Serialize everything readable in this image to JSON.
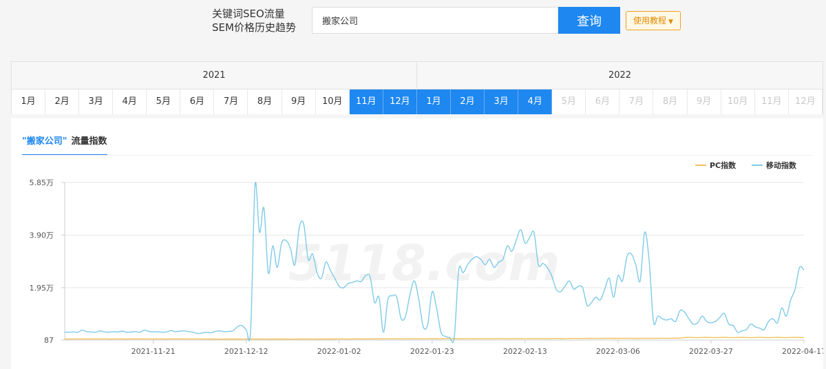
{
  "header": {
    "label_line1": "关键词SEO流量",
    "label_line2": "SEM价格历史趋势",
    "search_value": "搬家公司",
    "search_button": "查询",
    "tutorial_button": "使用教程",
    "accent_color": "#1e87f0"
  },
  "months": {
    "years": [
      "2021",
      "2022"
    ],
    "year_2021": [
      {
        "label": "1月",
        "state": "normal"
      },
      {
        "label": "2月",
        "state": "normal"
      },
      {
        "label": "3月",
        "state": "normal"
      },
      {
        "label": "4月",
        "state": "normal"
      },
      {
        "label": "5月",
        "state": "normal"
      },
      {
        "label": "6月",
        "state": "normal"
      },
      {
        "label": "7月",
        "state": "normal"
      },
      {
        "label": "8月",
        "state": "normal"
      },
      {
        "label": "9月",
        "state": "normal"
      },
      {
        "label": "10月",
        "state": "normal"
      },
      {
        "label": "11月",
        "state": "active"
      },
      {
        "label": "12月",
        "state": "active"
      }
    ],
    "year_2022": [
      {
        "label": "1月",
        "state": "active"
      },
      {
        "label": "2月",
        "state": "active"
      },
      {
        "label": "3月",
        "state": "active"
      },
      {
        "label": "4月",
        "state": "active"
      },
      {
        "label": "5月",
        "state": "disabled"
      },
      {
        "label": "6月",
        "state": "disabled"
      },
      {
        "label": "7月",
        "state": "disabled"
      },
      {
        "label": "8月",
        "state": "disabled"
      },
      {
        "label": "9月",
        "state": "disabled"
      },
      {
        "label": "10月",
        "state": "disabled"
      },
      {
        "label": "11月",
        "state": "disabled"
      },
      {
        "label": "12月",
        "state": "disabled"
      }
    ]
  },
  "panel": {
    "tab_keyword": "\"搬家公司\"",
    "tab_title": "流量指数"
  },
  "chart_data": {
    "type": "line",
    "title": "",
    "y_tick_labels": [
      "87",
      "1.95万",
      "3.90万",
      "5.85万"
    ],
    "y_tick_values": [
      87,
      19500,
      39000,
      58500
    ],
    "ylim": [
      87,
      58500
    ],
    "x_tick_labels": [
      "2021-11-21",
      "2021-12-12",
      "2022-01-02",
      "2022-01-23",
      "2022-02-13",
      "2022-03-06",
      "2022-03-27",
      "2022-04-17"
    ],
    "x_range": [
      "2021-11-01",
      "2022-04-17"
    ],
    "grid": "horizontal",
    "legend_position": "top-right",
    "watermark": "5118.com",
    "series": [
      {
        "name": "PC指数",
        "color": "#f0c05a",
        "values": [
          500,
          500,
          520,
          500,
          510,
          500,
          510,
          520,
          500,
          510,
          500,
          500,
          520,
          510,
          500,
          510,
          500,
          520,
          500,
          510,
          500,
          520,
          510,
          500,
          510,
          500,
          520,
          500,
          510,
          500,
          520,
          500,
          500,
          480,
          470,
          450,
          460,
          480,
          470,
          460,
          450,
          470,
          480,
          460,
          470,
          450,
          460,
          480,
          470,
          460,
          470,
          450,
          460,
          480,
          470,
          460,
          450,
          470,
          480,
          460,
          480,
          500,
          520,
          510,
          500,
          520,
          540,
          530,
          520,
          540,
          560,
          550,
          540,
          560,
          580,
          560,
          550,
          570,
          580,
          560,
          570,
          580,
          600,
          590,
          580,
          600,
          610,
          600,
          590,
          600,
          620,
          610,
          600,
          620,
          630,
          610,
          620,
          630,
          640,
          620,
          630,
          640,
          650,
          640,
          630,
          650,
          660,
          650,
          640,
          660,
          680,
          670,
          660,
          680,
          700,
          690,
          680,
          700,
          720,
          710,
          700,
          720,
          740,
          730,
          720,
          740,
          750,
          740,
          730,
          740,
          760,
          750,
          740,
          760,
          780,
          770,
          760,
          780,
          800,
          1000,
          1100,
          1050,
          1000,
          1050,
          1100,
          1050,
          1000,
          1050,
          1100,
          1050,
          1000,
          1050,
          1100,
          1050,
          1000,
          1050,
          1100,
          1050,
          1000,
          1050,
          1100,
          1050,
          1000,
          1050,
          1100,
          1050,
          1000
        ]
      },
      {
        "name": "移动指数",
        "color": "#7ecae8",
        "values": [
          3000,
          3000,
          3100,
          3000,
          3800,
          3200,
          3100,
          3000,
          3500,
          3100,
          3000,
          3200,
          3100,
          3400,
          3000,
          3100,
          3200,
          3000,
          3800,
          3300,
          3100,
          3200,
          3000,
          3100,
          3600,
          3200,
          3400,
          3500,
          3200,
          3000,
          2500,
          2700,
          3000,
          2800,
          3300,
          3500,
          3200,
          3300,
          3500,
          5000,
          5500,
          4000,
          3800,
          57500,
          40000,
          49000,
          25000,
          35000,
          27000,
          36000,
          37000,
          34000,
          28000,
          42000,
          43000,
          30000,
          32000,
          25000,
          23000,
          29000,
          26000,
          23000,
          20000,
          19500,
          21000,
          21500,
          22000,
          21800,
          24000,
          23500,
          14000,
          16000,
          3000,
          15000,
          16500,
          16000,
          8000,
          9000,
          17000,
          22000,
          15000,
          5000,
          6000,
          18000,
          12000,
          3000,
          1500,
          1000,
          1000,
          26000,
          25000,
          28000,
          30000,
          31000,
          30000,
          28000,
          30000,
          27000,
          29000,
          30000,
          35000,
          33000,
          37000,
          41000,
          36000,
          38000,
          40000,
          28000,
          28500,
          27000,
          24000,
          19000,
          18000,
          20000,
          22000,
          19000,
          20000,
          19500,
          13000,
          14000,
          16000,
          15000,
          19000,
          23000,
          16000,
          24000,
          22000,
          31000,
          32000,
          28000,
          22000,
          40000,
          30000,
          7000,
          9000,
          8000,
          7500,
          8000,
          7000,
          11000,
          10500,
          8000,
          6000,
          6500,
          9000,
          7000,
          6500,
          7000,
          8500,
          10000,
          6000,
          5500,
          3000,
          3500,
          4000,
          6000,
          5000,
          4500,
          4000,
          7000,
          8000,
          6500,
          12000,
          9000,
          15000,
          19000,
          27000,
          26000
        ]
      }
    ]
  }
}
